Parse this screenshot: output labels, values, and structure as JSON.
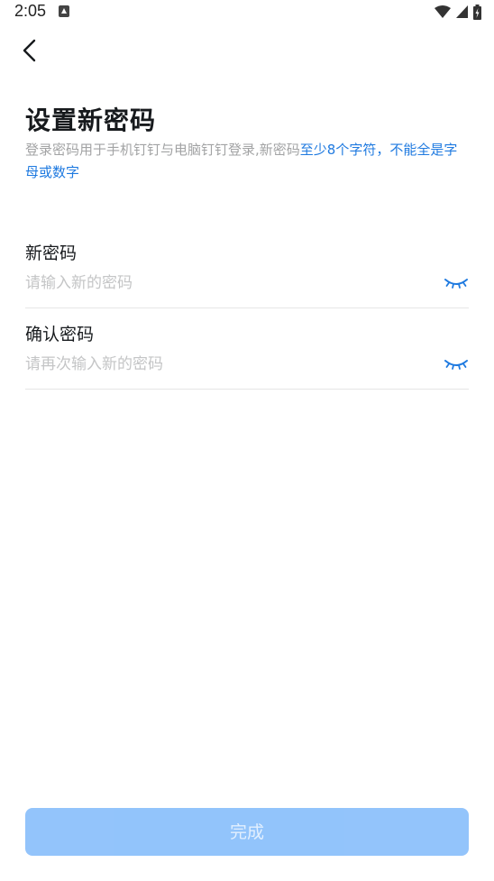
{
  "status_bar": {
    "time": "2:05",
    "notification_icon": "text-notification-icon",
    "icons": [
      "wifi-icon",
      "cellular-signal-icon",
      "battery-charging-icon"
    ]
  },
  "nav": {
    "back_icon": "chevron-left-icon"
  },
  "header": {
    "title": "设置新密码",
    "description_plain": "登录密码用于手机钉钉与电脑钉钉登录,新密码",
    "description_highlight": "至少8个字符，不能全是字母或数字"
  },
  "form": {
    "new_password": {
      "label": "新密码",
      "placeholder": "请输入新的密码",
      "value": "",
      "toggle_icon": "eye-closed-icon"
    },
    "confirm_password": {
      "label": "确认密码",
      "placeholder": "请再次输入新的密码",
      "value": "",
      "toggle_icon": "eye-closed-icon"
    }
  },
  "actions": {
    "submit_label": "完成",
    "submit_enabled": false
  },
  "colors": {
    "accent": "#1f7ae0",
    "button_disabled": "#8dc1fb",
    "placeholder": "#c4c5c6",
    "divider": "#e6e6e6"
  }
}
